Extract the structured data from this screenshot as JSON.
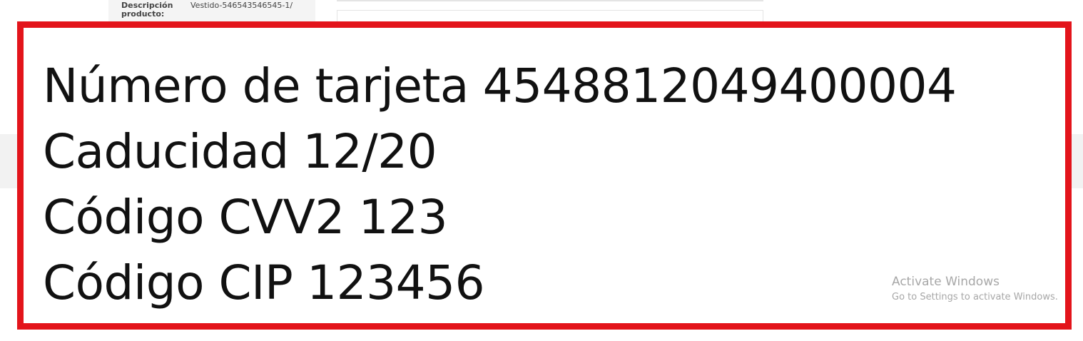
{
  "background_page": {
    "field_label": "Descripción producto:",
    "field_value": "Vestido-546543546545-1/"
  },
  "card_details": {
    "card_number": {
      "label": "Número de tarjeta",
      "value": "4548812049400004"
    },
    "expiry": {
      "label": "Caducidad",
      "value": "12/20"
    },
    "cvv2": {
      "label": "Código CVV2",
      "value": "123"
    },
    "cip": {
      "label": "Código CIP",
      "value": "123456"
    }
  },
  "watermark": {
    "title": "Activate Windows",
    "subtitle": "Go to Settings to activate Windows."
  },
  "colors": {
    "highlight_border": "#e3141b",
    "text": "#111111",
    "watermark": "#a7a7a7"
  }
}
